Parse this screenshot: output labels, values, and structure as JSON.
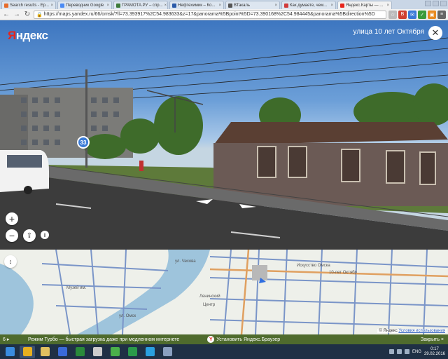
{
  "browser": {
    "tabs": [
      {
        "title": "Search results - Ер...",
        "color": "#e66b2b"
      },
      {
        "title": "Переводчик Google",
        "color": "#4a8af4"
      },
      {
        "title": "ГРАМОТА.РУ – спр...",
        "color": "#3d7a3a"
      },
      {
        "title": "Нефтехимик – Ко...",
        "color": "#2b5aa8"
      },
      {
        "title": "ВТакаль",
        "color": "#555555"
      },
      {
        "title": "Как думаете, чем...",
        "color": "#d03b3b"
      },
      {
        "title": "Яндекс.Карты — ...",
        "color": "#e7241b",
        "active": true
      }
    ],
    "url": "https://maps.yandex.ru/66/omsk/?ll=73.393917%2C54.983633&z=17&panorama%5Bpoint%5D=73.390168%2C54.984445&panorama%5Bdirection%5D",
    "nav": {
      "back": "←",
      "forward": "→",
      "reload": "↻",
      "lock": "🔒"
    },
    "extensions": [
      {
        "glyph": "☆",
        "color": "#bbbbbb"
      },
      {
        "glyph": "В",
        "color": "#d04030"
      },
      {
        "glyph": "✉",
        "color": "#3a7ad8"
      },
      {
        "glyph": "✓",
        "color": "#3a9a3a"
      },
      {
        "glyph": "▣",
        "color": "#e88a20"
      },
      {
        "glyph": "≡",
        "color": "#666666"
      }
    ]
  },
  "panorama": {
    "brand_first": "Я",
    "brand_rest": "ндекс",
    "street": "улица 10 лет Октября",
    "close": "✕",
    "badge": "33",
    "zoom_in": "+",
    "zoom_out": "−",
    "share": "⇪",
    "info": "i"
  },
  "map": {
    "collapse": "↕",
    "labels": {
      "leninsky": "Ленинский",
      "tsentr": "Центр",
      "iskusstv": "Искусство Омска",
      "oktyabr": "10-лет Октябр",
      "muzh": "Музей им.",
      "chekhov": "ул. Чехова",
      "omsk": "ул. Омск"
    },
    "copyright_prefix": "© Яндекс",
    "terms": "Условия использования"
  },
  "promo": {
    "download": "6 ▸",
    "turbo": "Режим Турбо — быстрая загрузка даже при медленном интернете",
    "ylogo": "Y",
    "install": "Установить Яндекс.Браузер",
    "close": "Закрыть ×"
  },
  "taskbar": {
    "apps": [
      {
        "name": "windows",
        "color": "#3a8ce0"
      },
      {
        "name": "chrome",
        "color": "#e8b020"
      },
      {
        "name": "explorer",
        "color": "#e0c060"
      },
      {
        "name": "search",
        "color": "#3a6ad8"
      },
      {
        "name": "excel",
        "color": "#2a8a3a"
      },
      {
        "name": "game",
        "color": "#cccccc"
      },
      {
        "name": "phone",
        "color": "#4ab04a"
      },
      {
        "name": "torrent",
        "color": "#2a9a4a"
      },
      {
        "name": "skype",
        "color": "#2aa0e0"
      },
      {
        "name": "paint",
        "color": "#8aa0c0"
      }
    ],
    "lang": "ENG",
    "time": "0:17",
    "date": "29.02.2016"
  },
  "colors": {
    "yandex_red": "#e7241b",
    "promo_bg": "#4f6b2d",
    "taskbar_bg": "#1f3045",
    "road": "#7a95c8"
  }
}
